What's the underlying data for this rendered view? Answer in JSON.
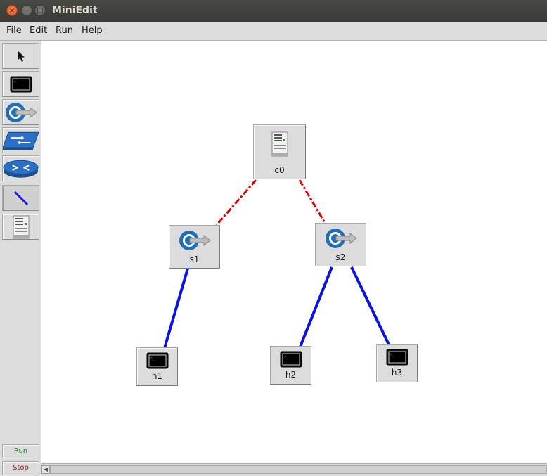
{
  "window": {
    "title": "MiniEdit",
    "close": "×",
    "minimize": "–",
    "maximize": "□"
  },
  "menu": [
    "File",
    "Edit",
    "Run",
    "Help"
  ],
  "toolbar": {
    "tools": [
      "select-tool",
      "host-tool",
      "switch-tool",
      "legacy-switch-tool",
      "router-tool",
      "netlink-tool",
      "controller-tool"
    ],
    "active": "netlink-tool",
    "run_label": "Run",
    "stop_label": "Stop",
    "run_color": "#2a7a2a",
    "stop_color": "#8a1f1f"
  },
  "topology": {
    "nodes": [
      {
        "id": "c0",
        "type": "controller"
      },
      {
        "id": "s1",
        "type": "switch"
      },
      {
        "id": "s2",
        "type": "switch"
      },
      {
        "id": "h1",
        "type": "host"
      },
      {
        "id": "h2",
        "type": "host"
      },
      {
        "id": "h3",
        "type": "host"
      }
    ],
    "links": [
      {
        "from": "c0",
        "to": "s1",
        "kind": "control",
        "color": "#e00000",
        "style": "dash-dot"
      },
      {
        "from": "c0",
        "to": "s2",
        "kind": "control",
        "color": "#e00000",
        "style": "dash-dot"
      },
      {
        "from": "s1",
        "to": "h1",
        "kind": "data",
        "color": "#0a14e0",
        "style": "solid"
      },
      {
        "from": "s2",
        "to": "h2",
        "kind": "data",
        "color": "#0a14e0",
        "style": "solid"
      },
      {
        "from": "s2",
        "to": "h3",
        "kind": "data",
        "color": "#0a14e0",
        "style": "solid"
      }
    ]
  }
}
